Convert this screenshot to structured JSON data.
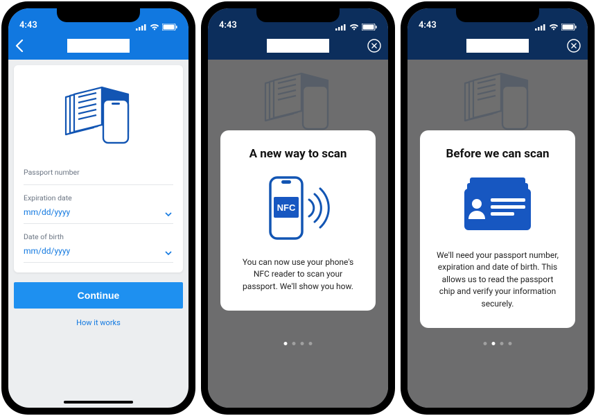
{
  "status": {
    "time": "4:43"
  },
  "screen1": {
    "fields": {
      "passport_label": "Passport number",
      "exp_label": "Expiration date",
      "exp_value": "mm/dd/yyyy",
      "dob_label": "Date of birth",
      "dob_value": "mm/dd/yyyy"
    },
    "continue_label": "Continue",
    "how_link": "How it works"
  },
  "screen2": {
    "title": "A new way to scan",
    "nfc_badge": "NFC",
    "body": "You can now use your phone's NFC reader to scan your passport. We'll show you how.",
    "page_index": 0,
    "page_count": 4
  },
  "screen3": {
    "title": "Before we can scan",
    "body": "We'll need your passport number, expiration and date of birth. This allows us to read the passport chip and verify your information securely.",
    "page_index": 1,
    "page_count": 4
  }
}
